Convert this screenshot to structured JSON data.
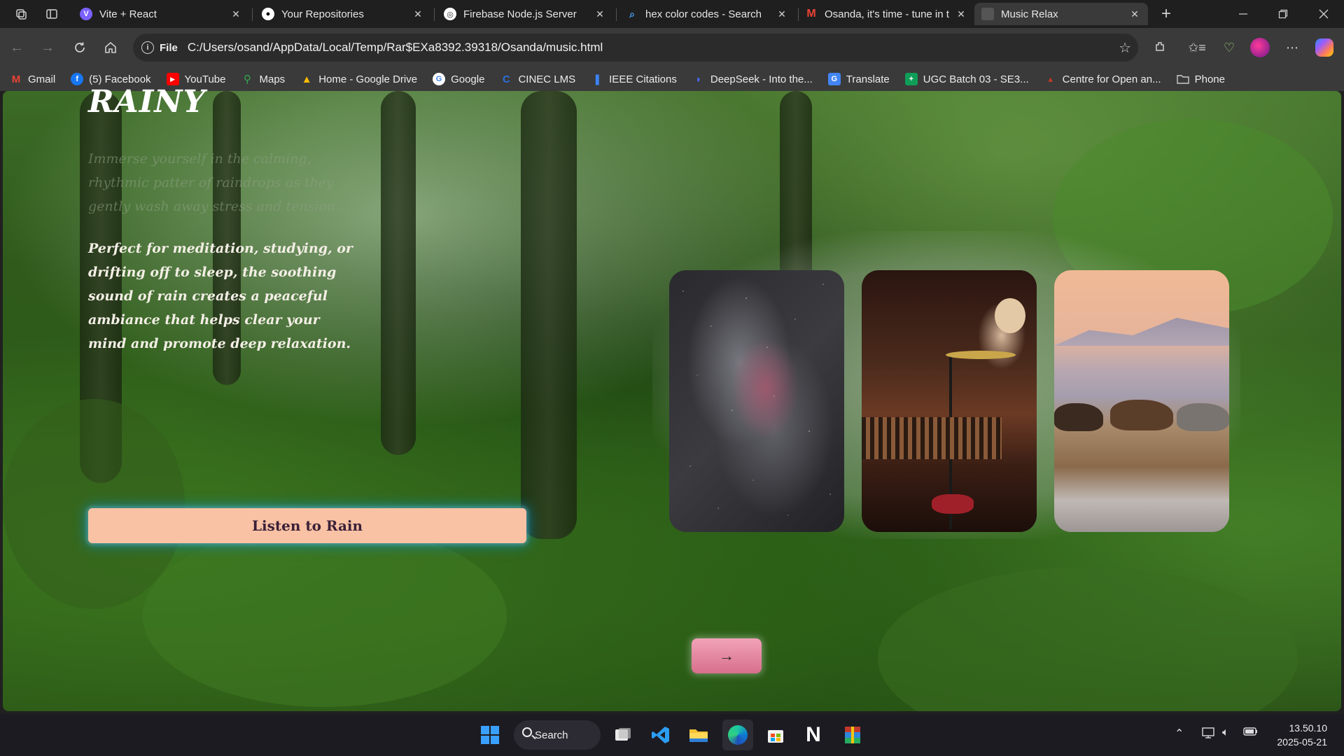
{
  "browser": {
    "tabs": [
      {
        "title": "Vite + React",
        "icon": "vite-icon",
        "active": false
      },
      {
        "title": "Your Repositories",
        "icon": "github-icon",
        "active": false
      },
      {
        "title": "Firebase Node.js Server",
        "icon": "firebase-icon",
        "active": false
      },
      {
        "title": "hex color codes - Search",
        "icon": "search-icon",
        "active": false
      },
      {
        "title": "Osanda, it's time - tune in t",
        "icon": "gmail-icon",
        "active": false
      },
      {
        "title": "Music Relax",
        "icon": "page-icon",
        "active": true
      }
    ],
    "address": {
      "scheme": "File",
      "url": "C:/Users/osand/AppData/Local/Temp/Rar$EXa8392.39318/Osanda/music.html"
    },
    "bookmarks": [
      {
        "label": "Gmail",
        "icon": "gmail-icon",
        "color": "#ea4335"
      },
      {
        "label": "(5) Facebook",
        "icon": "facebook-icon",
        "color": "#1877f2"
      },
      {
        "label": "YouTube",
        "icon": "youtube-icon",
        "color": "#ff0000"
      },
      {
        "label": "Maps",
        "icon": "maps-icon",
        "color": "#34a853"
      },
      {
        "label": "Home - Google Drive",
        "icon": "drive-icon",
        "color": "#fbbc04"
      },
      {
        "label": "Google",
        "icon": "google-icon",
        "color": "#ffffff"
      },
      {
        "label": "CINEC LMS",
        "icon": "cinec-icon",
        "color": "#2a6fdb"
      },
      {
        "label": "IEEE Citations",
        "icon": "bookmark-icon",
        "color": "#3b82f6"
      },
      {
        "label": "DeepSeek - Into the...",
        "icon": "deepseek-icon",
        "color": "#4d6bfe"
      },
      {
        "label": "Translate",
        "icon": "translate-icon",
        "color": "#4285f4"
      },
      {
        "label": "UGC Batch 03 - SE3...",
        "icon": "sheets-icon",
        "color": "#0f9d58"
      },
      {
        "label": "Centre for Open an...",
        "icon": "site-icon",
        "color": "#c0392b"
      },
      {
        "label": "Phone",
        "icon": "folder-icon",
        "color": "#cccccc"
      }
    ]
  },
  "page": {
    "title": "RAINY",
    "intro": "Immerse yourself in the calming, rhythmic patter of raindrops as they gently wash away stress and tension.",
    "body": "Perfect for meditation, studying, or drifting off to sleep, the soothing sound of rain creates a peaceful ambiance that helps clear your mind and promote deep relaxation.",
    "cta_label": "Listen to Rain",
    "next_label": "→",
    "cards": [
      {
        "subject": "galaxy-night-sky"
      },
      {
        "subject": "percussionist-playing"
      },
      {
        "subject": "horses-at-dusk"
      }
    ],
    "colors": {
      "cta_background": "#f9c2a4",
      "cta_text": "#3b2038",
      "cta_glow": "#008cc8",
      "next_button": "#e288a2"
    }
  },
  "taskbar": {
    "search_label": "Search",
    "apps": [
      "windows-start-icon",
      "task-view-icon",
      "vscode-icon",
      "file-explorer-icon",
      "edge-icon",
      "store-icon",
      "notion-icon",
      "winrar-icon"
    ],
    "time": "13.50.10",
    "date": "2025-05-21"
  }
}
